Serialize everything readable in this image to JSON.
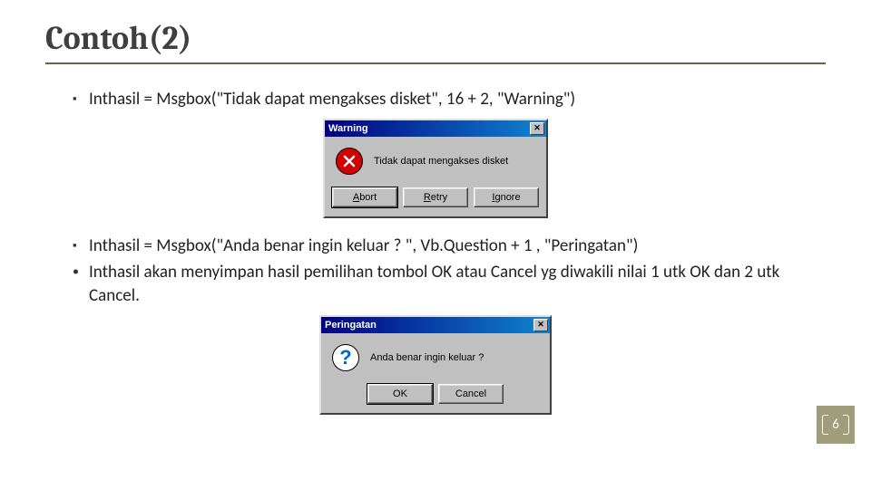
{
  "title": "Contoh(2)",
  "bullet1": "Inthasil = Msgbox(\"Tidak dapat mengakses disket\", 16 + 2, \"Warning\")",
  "bullet2": "Inthasil = Msgbox(\"Anda benar ingin keluar ? \", Vb.Question + 1 , \"Peringatan\")",
  "bullet3": "Inthasil akan menyimpan hasil pemilihan tombol OK atau Cancel yg diwakili nilai 1 utk OK dan 2 utk Cancel.",
  "msgbox1": {
    "title": "Warning",
    "message": "Tidak dapat mengakses disket",
    "close": "✕",
    "buttons": {
      "abort": "Abort",
      "retry": "Retry",
      "ignore": "Ignore"
    },
    "underline": {
      "abort": "A",
      "retry": "R",
      "ignore": "I"
    }
  },
  "msgbox2": {
    "title": "Peringatan",
    "message": "Anda benar ingin keluar ?",
    "close": "✕",
    "question_mark": "?",
    "buttons": {
      "ok": "OK",
      "cancel": "Cancel"
    }
  },
  "page_number": "6"
}
